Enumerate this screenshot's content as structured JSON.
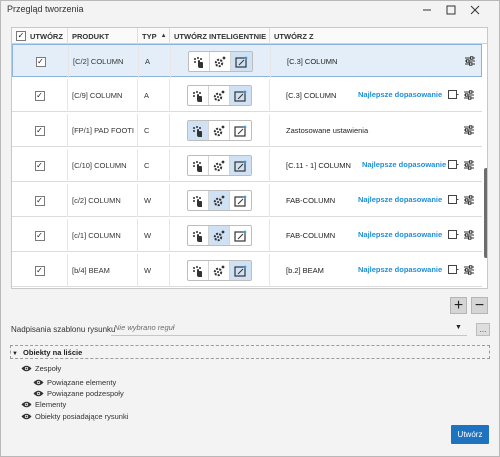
{
  "window": {
    "title": "Przegląd tworzenia"
  },
  "columns": {
    "create": "UTWÓRZ",
    "product": "PRODUKT",
    "type": "TYP",
    "smart": "UTWÓRZ INTELIGENTNIE",
    "from": "UTWÓRZ Z"
  },
  "rows": [
    {
      "product": "[C/2] COLUMN",
      "type": "A",
      "from": "[C.3] COLUMN",
      "best": "",
      "selected": true,
      "active_seg": 2
    },
    {
      "product": "[C/9] COLUMN",
      "type": "A",
      "from": "[C.3] COLUMN",
      "best": "Najlepsze dopasowanie",
      "selected": false,
      "active_seg": 2
    },
    {
      "product": "[FP/1] PAD FOOTI",
      "type": "C",
      "from": "Zastosowane ustawienia",
      "best": "",
      "selected": false,
      "active_seg": 0
    },
    {
      "product": "[C/10] COLUMN",
      "type": "C",
      "from": "[C.11 - 1] COLUMN",
      "best": "Najlepsze dopasowanie",
      "selected": false,
      "active_seg": 2
    },
    {
      "product": "[c/2] COLUMN",
      "type": "W",
      "from": "FAB-COLUMN",
      "best": "Najlepsze dopasowanie",
      "selected": false,
      "active_seg": 1
    },
    {
      "product": "[c/1] COLUMN",
      "type": "W",
      "from": "FAB-COLUMN",
      "best": "Najlepsze dopasowanie",
      "selected": false,
      "active_seg": 1
    },
    {
      "product": "[b/4] BEAM",
      "type": "W",
      "from": "[b.2] BEAM",
      "best": "Najlepsze dopasowanie",
      "selected": false,
      "active_seg": 2
    }
  ],
  "template": {
    "label": "Nadpisania szablonu rysunku",
    "placeholder": "Nie wybrano reguł",
    "browse_label": "..."
  },
  "tree": {
    "header": "Obiekty na liście",
    "items": [
      {
        "label": "Zespoły",
        "level": 0
      },
      {
        "label": "Powiązane elementy",
        "level": 1
      },
      {
        "label": "Powiązane podzespoły",
        "level": 1
      },
      {
        "label": "Elementy",
        "level": 0
      },
      {
        "label": "Obiekty posiadające rysunki",
        "level": 0
      }
    ]
  },
  "actions": {
    "add": "+",
    "remove": "−",
    "create": "Utwórz"
  },
  "colors": {
    "accent": "#1e73c1",
    "best_match": "#1f8fd6",
    "selected_row": "#e3eef9"
  }
}
